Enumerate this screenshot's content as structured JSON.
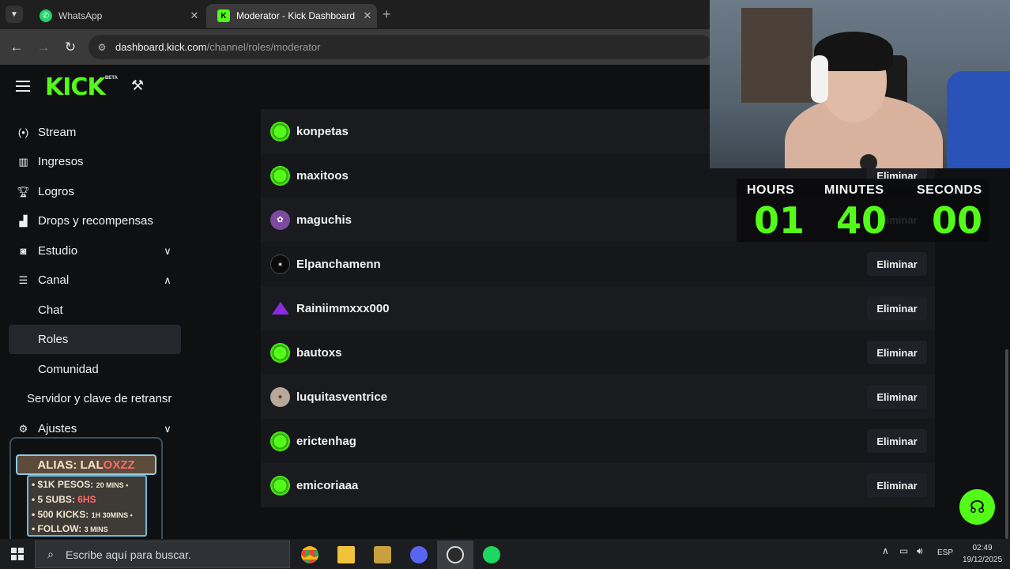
{
  "browser": {
    "tabs": [
      {
        "title": "WhatsApp",
        "icon": "whatsapp-icon"
      },
      {
        "title": "Moderator - Kick Dashboard",
        "icon": "kick-icon",
        "active": true
      }
    ],
    "address": {
      "host": "dashboard.kick.com",
      "path": "/channel/roles/moderator"
    }
  },
  "header": {
    "logo": "KICK",
    "beta": "BETA"
  },
  "sidebar": {
    "items": [
      {
        "label": "Stream",
        "icon": "broadcast-icon"
      },
      {
        "label": "Ingresos",
        "icon": "chart-icon"
      },
      {
        "label": "Logros",
        "icon": "trophy-icon"
      },
      {
        "label": "Drops y recompensas",
        "icon": "gift-icon"
      },
      {
        "label": "Estudio",
        "icon": "studio-icon",
        "expandable": true,
        "expanded": false
      },
      {
        "label": "Canal",
        "icon": "channel-icon",
        "expandable": true,
        "expanded": true
      },
      {
        "label": "Chat",
        "sub": true
      },
      {
        "label": "Roles",
        "sub": true,
        "active": true
      },
      {
        "label": "Comunidad",
        "sub": true
      },
      {
        "label": "Servidor y clave de retransr"
      },
      {
        "label": "Ajustes",
        "icon": "gear-icon",
        "expandable": true,
        "expanded": false
      }
    ]
  },
  "moderators": {
    "remove_label": "Eliminar",
    "rows": [
      {
        "name": "konpetas",
        "avatar": "kick"
      },
      {
        "name": "maxitoos",
        "avatar": "kick"
      },
      {
        "name": "maguchis",
        "avatar": "pink"
      },
      {
        "name": "Elpanchamenn",
        "avatar": "dark"
      },
      {
        "name": "Rainiimmxxx000",
        "avatar": "tri"
      },
      {
        "name": "bautoxs",
        "avatar": "kick"
      },
      {
        "name": "luquitasventrice",
        "avatar": "photo"
      },
      {
        "name": "erictenhag",
        "avatar": "kick"
      },
      {
        "name": "emicoriaaa",
        "avatar": "kick"
      }
    ]
  },
  "timer": {
    "labels": {
      "hours": "HOURS",
      "minutes": "MINUTES",
      "seconds": "SECONDS"
    },
    "values": {
      "hours": "01",
      "minutes": "40",
      "seconds": "00"
    }
  },
  "alias_sign": {
    "alias_prefix": "ALIAS: LAL",
    "alias_highlight": "OXZZ",
    "lines": [
      {
        "main": "• $1K PESOS: ",
        "small": "20 MINS •"
      },
      {
        "main": "• 5 SUBS: ",
        "red": "6HS"
      },
      {
        "main": "• 500 KICKS: ",
        "small": "1H 30MINS •"
      },
      {
        "main": "• FOLLOW: ",
        "small": "3 MINS"
      }
    ]
  },
  "taskbar": {
    "search_placeholder": "Escribe aquí para buscar.",
    "language": "ESP",
    "time": "02:49",
    "date": "19/12/2025"
  },
  "colors": {
    "accent": "#53fc18",
    "background": "#0f1012",
    "row_odd": "#191b1f",
    "row_even": "#15171a"
  }
}
